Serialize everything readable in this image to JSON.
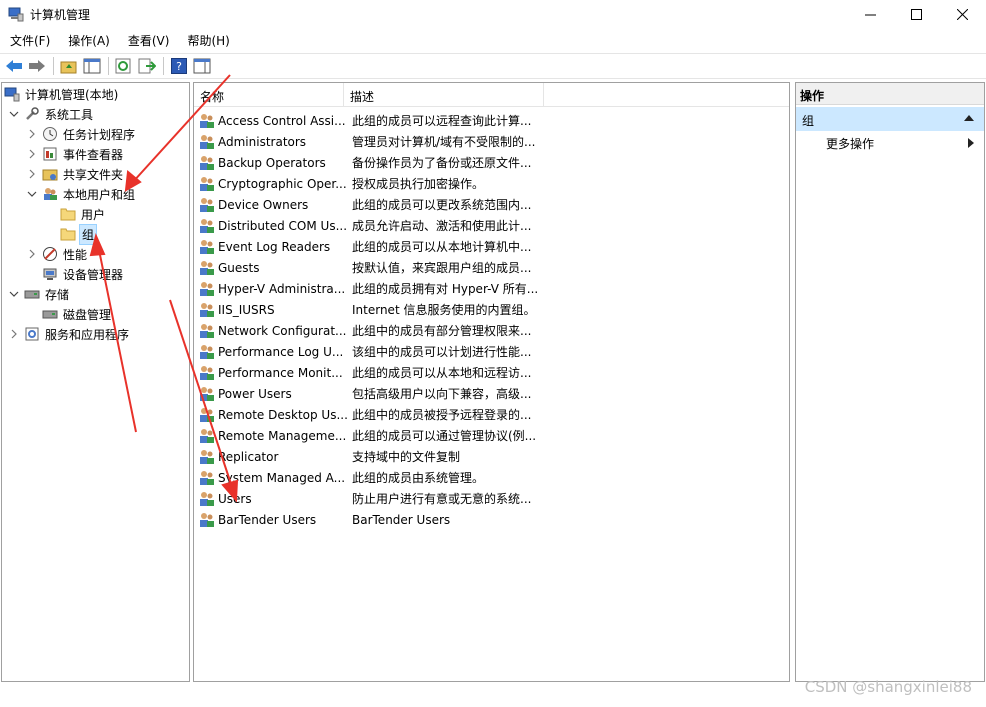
{
  "window": {
    "title": "计算机管理"
  },
  "menu": [
    "文件(F)",
    "操作(A)",
    "查看(V)",
    "帮助(H)"
  ],
  "tree": {
    "root": "计算机管理(本地)",
    "system_tools": "系统工具",
    "task_scheduler": "任务计划程序",
    "event_viewer": "事件查看器",
    "shared_folders": "共享文件夹",
    "local_users_groups": "本地用户和组",
    "users": "用户",
    "groups": "组",
    "performance": "性能",
    "device_manager": "设备管理器",
    "storage": "存储",
    "disk_management": "磁盘管理",
    "services_apps": "服务和应用程序"
  },
  "list": {
    "columns": [
      "名称",
      "描述"
    ],
    "rows": [
      {
        "name": "Access Control Assi...",
        "desc": "此组的成员可以远程查询此计算..."
      },
      {
        "name": "Administrators",
        "desc": "管理员对计算机/域有不受限制的..."
      },
      {
        "name": "Backup Operators",
        "desc": "备份操作员为了备份或还原文件..."
      },
      {
        "name": "Cryptographic Oper...",
        "desc": "授权成员执行加密操作。"
      },
      {
        "name": "Device Owners",
        "desc": "此组的成员可以更改系统范围内..."
      },
      {
        "name": "Distributed COM Us...",
        "desc": "成员允许启动、激活和使用此计..."
      },
      {
        "name": "Event Log Readers",
        "desc": "此组的成员可以从本地计算机中..."
      },
      {
        "name": "Guests",
        "desc": "按默认值，来宾跟用户组的成员..."
      },
      {
        "name": "Hyper-V Administra...",
        "desc": "此组的成员拥有对 Hyper-V 所有..."
      },
      {
        "name": "IIS_IUSRS",
        "desc": "Internet 信息服务使用的内置组。"
      },
      {
        "name": "Network Configurat...",
        "desc": "此组中的成员有部分管理权限来..."
      },
      {
        "name": "Performance Log U...",
        "desc": "该组中的成员可以计划进行性能..."
      },
      {
        "name": "Performance Monit...",
        "desc": "此组的成员可以从本地和远程访..."
      },
      {
        "name": "Power Users",
        "desc": "包括高级用户以向下兼容，高级..."
      },
      {
        "name": "Remote Desktop Us...",
        "desc": "此组中的成员被授予远程登录的..."
      },
      {
        "name": "Remote Manageme...",
        "desc": "此组的成员可以通过管理协议(例..."
      },
      {
        "name": "Replicator",
        "desc": "支持域中的文件复制"
      },
      {
        "name": "System Managed A...",
        "desc": "此组的成员由系统管理。"
      },
      {
        "name": "Users",
        "desc": "防止用户进行有意或无意的系统..."
      },
      {
        "name": "BarTender Users",
        "desc": "BarTender Users"
      }
    ]
  },
  "actions": {
    "title": "操作",
    "section": "组",
    "more": "更多操作"
  },
  "watermark": "CSDN @shangxinlei88",
  "colors": {
    "selection": "#cce8ff",
    "arrow": "#e8322a"
  }
}
